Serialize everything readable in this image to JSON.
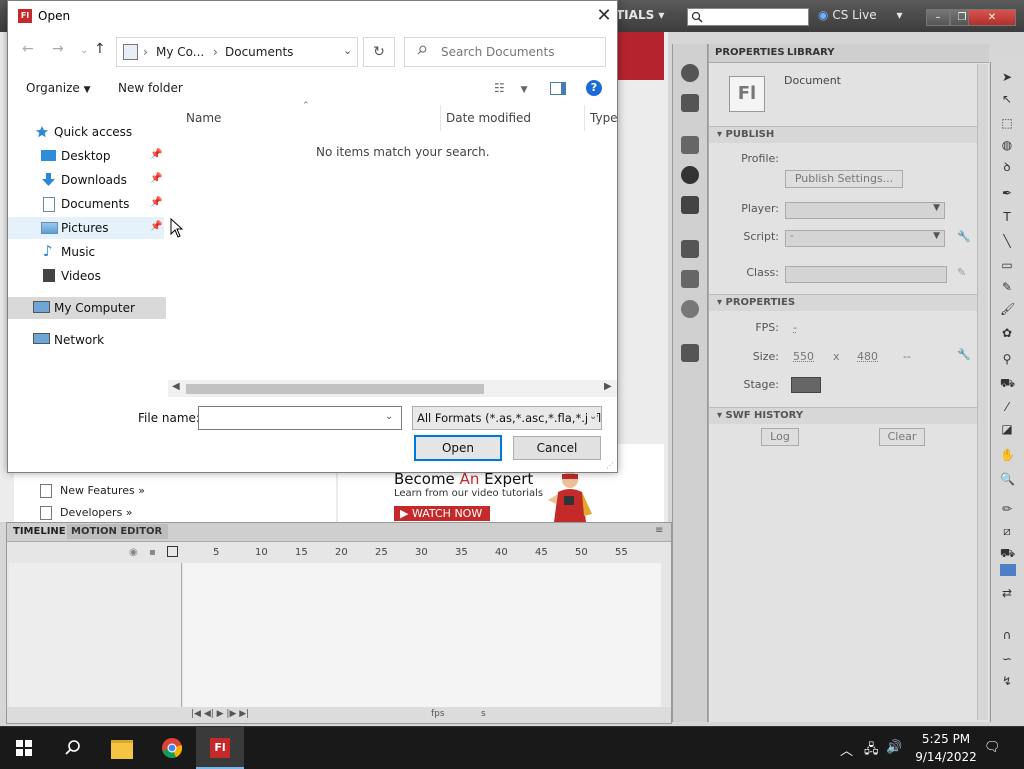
{
  "app": {
    "workspace": "TIALS",
    "cs_live": "CS Live",
    "welcome_links": [
      "New Features »",
      "Developers »"
    ],
    "ad": {
      "title_pre": "Become ",
      "title_accent": "An",
      "title_post": " Expert",
      "subtitle": "Learn from our video tutorials",
      "button": "WATCH NOW"
    },
    "timeline": {
      "tab_timeline": "TIMELINE",
      "tab_motion": "MOTION EDITOR",
      "frames": [
        "5",
        "10",
        "15",
        "20",
        "25",
        "30",
        "35",
        "40",
        "45",
        "50",
        "55"
      ],
      "fps_label": "fps",
      "s_label": "s"
    },
    "properties": {
      "tab_properties": "PROPERTIES",
      "tab_library": "LIBRARY",
      "doc_icon": "Fl",
      "doc_label": "Document",
      "publish_header": "PUBLISH",
      "profile_label": "Profile:",
      "publish_settings": "Publish Settings...",
      "player_label": "Player:",
      "script_label": "Script:",
      "script_value": "-",
      "class_label": "Class:",
      "properties_header": "PROPERTIES",
      "fps_label": "FPS:",
      "fps_value": "-",
      "size_label": "Size:",
      "width": "550",
      "x": "x",
      "height": "480",
      "size_unit": "--",
      "stage_label": "Stage:",
      "stage_color": "#666666",
      "swf_history_header": "SWF HISTORY",
      "log_btn": "Log",
      "clear_btn": "Clear"
    }
  },
  "dialog": {
    "title": "Open",
    "address": [
      "My Co...",
      "Documents"
    ],
    "search_placeholder": "Search Documents",
    "organize": "Organize",
    "new_folder": "New folder",
    "nav": [
      {
        "label": "Quick access",
        "icon": "star-icon"
      },
      {
        "label": "Desktop",
        "icon": "desktop-icon",
        "pinned": true
      },
      {
        "label": "Downloads",
        "icon": "download-arrow-icon",
        "pinned": true
      },
      {
        "label": "Documents",
        "icon": "documents-icon",
        "pinned": true
      },
      {
        "label": "Pictures",
        "icon": "pictures-icon",
        "pinned": true
      },
      {
        "label": "Music",
        "icon": "music-note-icon"
      },
      {
        "label": "Videos",
        "icon": "film-icon"
      },
      {
        "label": "My Computer",
        "icon": "computer-icon"
      },
      {
        "label": "Network",
        "icon": "network-icon"
      }
    ],
    "columns": [
      "Name",
      "Date modified",
      "Type"
    ],
    "empty_message": "No items match your search.",
    "file_name_label": "File name:",
    "file_name_value": "",
    "file_type": "All Formats (*.as,*.asc,*.fla,*.jsfl",
    "open_btn": "Open",
    "cancel_btn": "Cancel"
  },
  "taskbar": {
    "time": "5:25 PM",
    "date": "9/14/2022",
    "flash_label": "Fl"
  },
  "colors": {
    "accent": "#0078d7",
    "flash_red": "#c42a2a",
    "taskbar": "#191919"
  }
}
